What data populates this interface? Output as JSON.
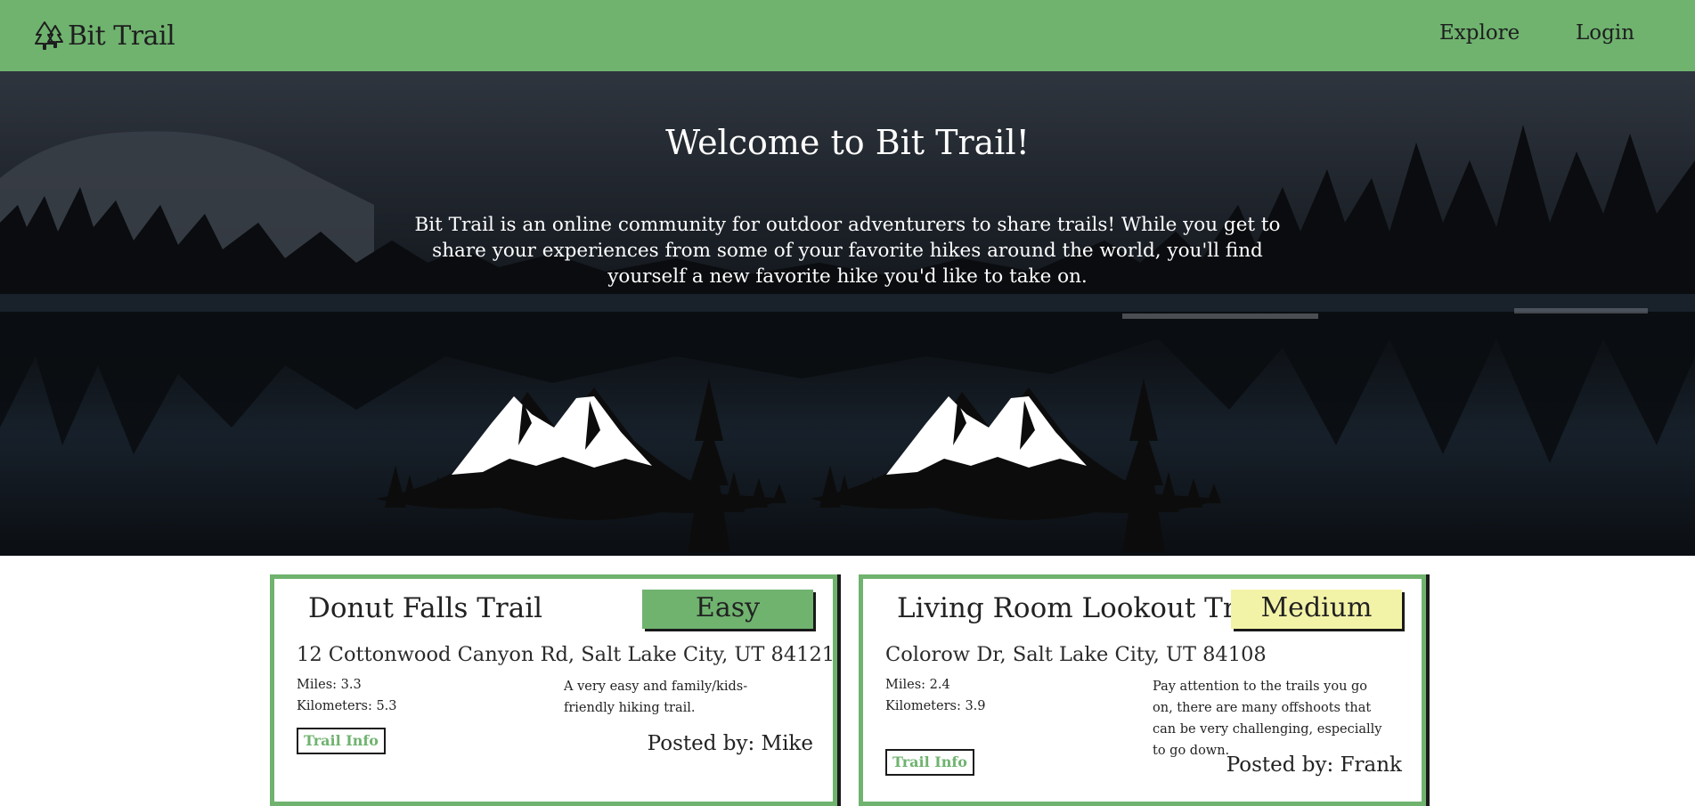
{
  "header": {
    "brand": "Bit Trail",
    "nav_links": [
      "Explore",
      "Login"
    ]
  },
  "hero": {
    "title": "Welcome to Bit Trail!",
    "description": "Bit Trail is an online community for outdoor adventurers to share trails! While you get to share your experiences from some of your favorite hikes around the world, you'll find yourself a new favorite hike you'd like to take on."
  },
  "trails": [
    {
      "name": "Donut Falls Trail",
      "difficulty": "Easy",
      "difficulty_color": "#6fb36f",
      "address": "12 Cottonwood Canyon Rd, Salt Lake City, UT 84121",
      "miles": "Miles: 3.3",
      "kilometers": "Kilometers: 5.3",
      "description": "A very easy and family/kids-friendly hiking trail.",
      "button": "Trail Info",
      "posted_by": "Posted by: Mike"
    },
    {
      "name": "Living Room Lookout Trail",
      "difficulty": "Medium",
      "difficulty_color": "#f3f3a8",
      "address": "Colorow Dr, Salt Lake City, UT 84108",
      "miles": "Miles: 2.4",
      "kilometers": "Kilometers: 3.9",
      "description": "Pay attention to the trails you go on, there are many offshoots that can be very challenging, especially to go down.",
      "button": "Trail Info",
      "posted_by": "Posted by: Frank"
    }
  ],
  "colors": {
    "brand_green": "#6fb36f",
    "medium_yellow": "#f3f3a8"
  },
  "icons": {
    "brand": "pine-trees-icon",
    "hero_art": "mountain-forest-silhouette"
  }
}
